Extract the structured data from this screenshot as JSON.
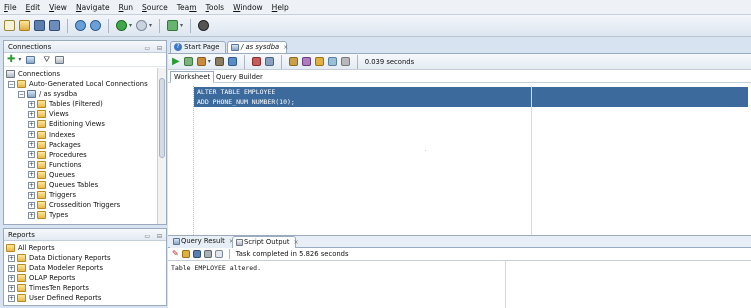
{
  "menu": [
    {
      "label": "File",
      "mnemonic": "F"
    },
    {
      "label": "Edit",
      "mnemonic": "E"
    },
    {
      "label": "View",
      "mnemonic": "V"
    },
    {
      "label": "Navigate",
      "mnemonic": "N"
    },
    {
      "label": "Run",
      "mnemonic": "R"
    },
    {
      "label": "Source",
      "mnemonic": "S"
    },
    {
      "label": "Team",
      "mnemonic": "m"
    },
    {
      "label": "Tools",
      "mnemonic": "T"
    },
    {
      "label": "Window",
      "mnemonic": "W"
    },
    {
      "label": "Help",
      "mnemonic": "H"
    }
  ],
  "connections": {
    "title": "Connections",
    "root": "Connections",
    "group": "Auto-Generated Local Connections",
    "connection": "/ as sysdba",
    "children": [
      "Tables (Filtered)",
      "Views",
      "Editioning Views",
      "Indexes",
      "Packages",
      "Procedures",
      "Functions",
      "Queues",
      "Queues Tables",
      "Triggers",
      "Crossedition Triggers",
      "Types"
    ]
  },
  "reports": {
    "title": "Reports",
    "root": "All Reports",
    "children": [
      "Data Dictionary Reports",
      "Data Modeler Reports",
      "OLAP Reports",
      "TimesTen Reports",
      "User Defined Reports"
    ]
  },
  "editor": {
    "tabs": [
      {
        "label": "Start Page"
      },
      {
        "label": "/ as sysdba"
      }
    ],
    "timing": "0.039 seconds",
    "subtabs": [
      "Worksheet",
      "Query Builder"
    ],
    "sql_lines": [
      "ALTER TABLE EMPLOYEE",
      "ADD PHONE_NUM NUMBER(10);"
    ]
  },
  "output": {
    "tabs": [
      {
        "label": "Query Result"
      },
      {
        "label": "Script Output"
      }
    ],
    "status": "Task completed in 5.826 seconds",
    "text": "Table EMPLOYEE altered."
  },
  "colors": {
    "selection": "#3c6a9c",
    "chrome": "#d7e3f0"
  }
}
